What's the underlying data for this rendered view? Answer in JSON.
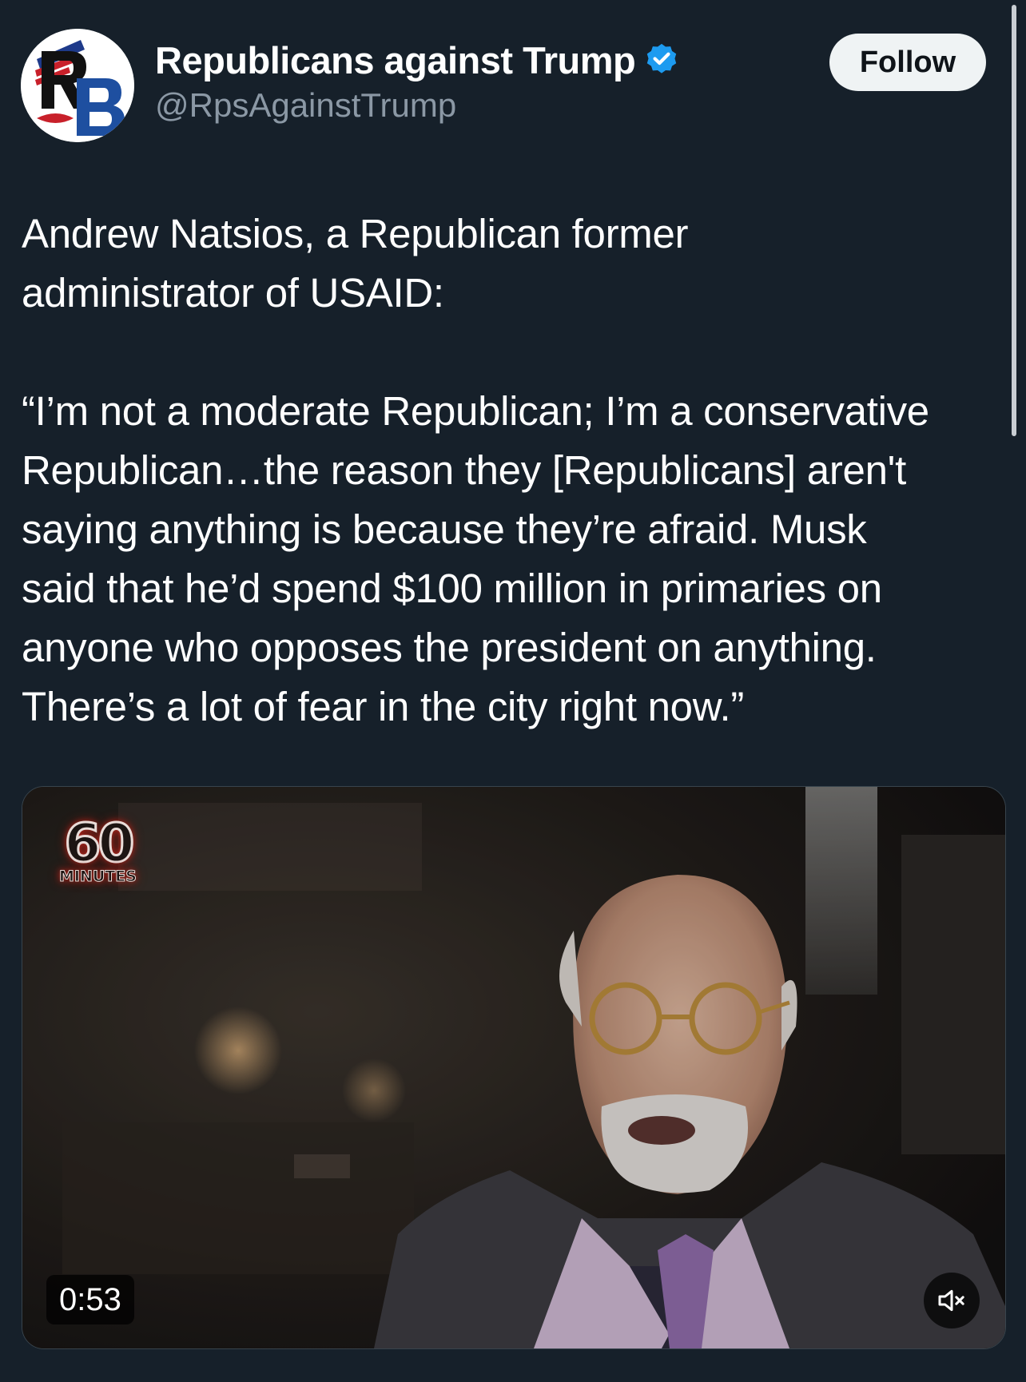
{
  "account": {
    "display_name": "Republicans against Trump",
    "handle": "@RpsAgainstTrump",
    "verified": true,
    "avatar_icon": "rb-logo-avatar"
  },
  "follow_button": {
    "label": "Follow"
  },
  "tweet": {
    "lines": [
      "Andrew Natsios, a Republican former",
      "administrator of USAID:",
      "",
      "“I’m not a moderate Republican; I’m a conservative",
      "Republican…the reason they [Republicans] aren't",
      "saying anything is because they’re afraid. Musk",
      "said that he’d spend $100 million in primaries on",
      "anyone who opposes the president on anything.",
      "There’s a lot of fear in the city right now.”"
    ]
  },
  "video": {
    "logo_number": "60",
    "logo_word": "MINUTES",
    "duration": "0:53",
    "mute_icon": "speaker-muted-icon"
  },
  "colors": {
    "background": "#16202a",
    "verified_badge": "#1d9bf0",
    "handle_text": "#8b98a5",
    "follow_button_bg": "#eff3f4"
  }
}
